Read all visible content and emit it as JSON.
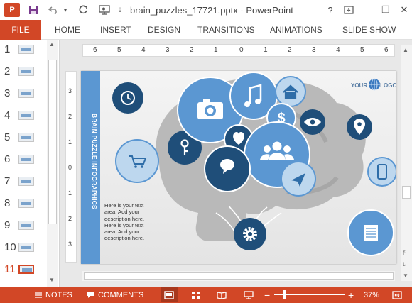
{
  "window": {
    "app_logo": "P",
    "title": "brain_puzzles_17721.pptx - PowerPoint",
    "help": "?",
    "minimize": "—",
    "maximize": "❐",
    "close": "✕"
  },
  "quick_access": {
    "save_icon": "floppy-icon",
    "undo_icon": "undo-icon",
    "redo_icon": "redo-icon",
    "present_icon": "present-icon",
    "customize_icon": "chevron-down-icon"
  },
  "ribbon": {
    "tabs": [
      "FILE",
      "HOME",
      "INSERT",
      "DESIGN",
      "TRANSITIONS",
      "ANIMATIONS",
      "SLIDE SHOW"
    ]
  },
  "thumbnails": {
    "numbers": [
      "1",
      "2",
      "3",
      "4",
      "5",
      "6",
      "7",
      "8",
      "9",
      "10",
      "11"
    ],
    "active": "11"
  },
  "ruler": {
    "horizontal": [
      "6",
      "5",
      "4",
      "3",
      "2",
      "1",
      "0",
      "1",
      "2",
      "3",
      "4",
      "5",
      "6"
    ],
    "vertical": [
      "3",
      "2",
      "1",
      "0",
      "1",
      "2",
      "3"
    ]
  },
  "slide": {
    "side_title": "BRAIN PUZZLE INFOGRAPHICS",
    "body_lines": [
      "Here is your text",
      "area. Add your",
      "description here.",
      "Here is your text",
      "area. Add your",
      "description here."
    ],
    "logo_your": "YOUR",
    "logo_logo": "LOGO",
    "colors": {
      "dark_blue": "#1f4e79",
      "mid_blue": "#5b97d2",
      "light_blue": "#bdd7ee",
      "brain_gray": "#b8b8b8"
    }
  },
  "statusbar": {
    "notes": "NOTES",
    "comments": "COMMENTS",
    "zoom_minus": "−",
    "zoom_plus": "+",
    "zoom_level": "37%"
  }
}
